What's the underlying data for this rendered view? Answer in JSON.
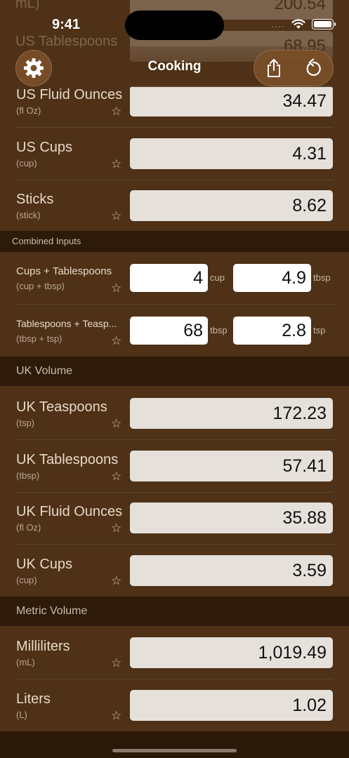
{
  "status": {
    "time": "9:41",
    "signal": "...."
  },
  "behind_nav": {
    "row1_label": "mL)",
    "row1_value": "200.54",
    "row2_label": "US Tablespoons",
    "row2_value": "68.95"
  },
  "nav": {
    "title": "Cooking",
    "settings_icon": "gear-icon",
    "share_icon": "share-icon",
    "reset_icon": "reset-icon"
  },
  "star": "☆",
  "us_rows": [
    {
      "label": "US Fluid Ounces",
      "unit": "(fl Oz)",
      "value": "34.47"
    },
    {
      "label": "US Cups",
      "unit": "(cup)",
      "value": "4.31"
    },
    {
      "label": "Sticks",
      "unit": "(stick)",
      "value": "8.62"
    }
  ],
  "combined": {
    "header": "Combined Inputs",
    "rows": [
      {
        "label": "Cups + Tablespoons",
        "unit": "(cup + tbsp)",
        "a_value": "4",
        "a_unit": "cup",
        "b_value": "4.9",
        "b_unit": "tbsp"
      },
      {
        "label": "Tablespoons + Teasp...",
        "unit": "(tbsp + tsp)",
        "a_value": "68",
        "a_unit": "tbsp",
        "b_value": "2.8",
        "b_unit": "tsp"
      }
    ]
  },
  "uk": {
    "header": "UK Volume",
    "rows": [
      {
        "label": "UK Teaspoons",
        "unit": "(tsp)",
        "value": "172.23"
      },
      {
        "label": "UK Tablespoons",
        "unit": "(tbsp)",
        "value": "57.41"
      },
      {
        "label": "UK Fluid Ounces",
        "unit": "(fl Oz)",
        "value": "35.88"
      },
      {
        "label": "UK Cups",
        "unit": "(cup)",
        "value": "3.59"
      }
    ]
  },
  "metric": {
    "header": "Metric Volume",
    "rows": [
      {
        "label": "Milliliters",
        "unit": "(mL)",
        "value": "1,019.49"
      },
      {
        "label": "Liters",
        "unit": "(L)",
        "value": "1.02"
      }
    ]
  }
}
